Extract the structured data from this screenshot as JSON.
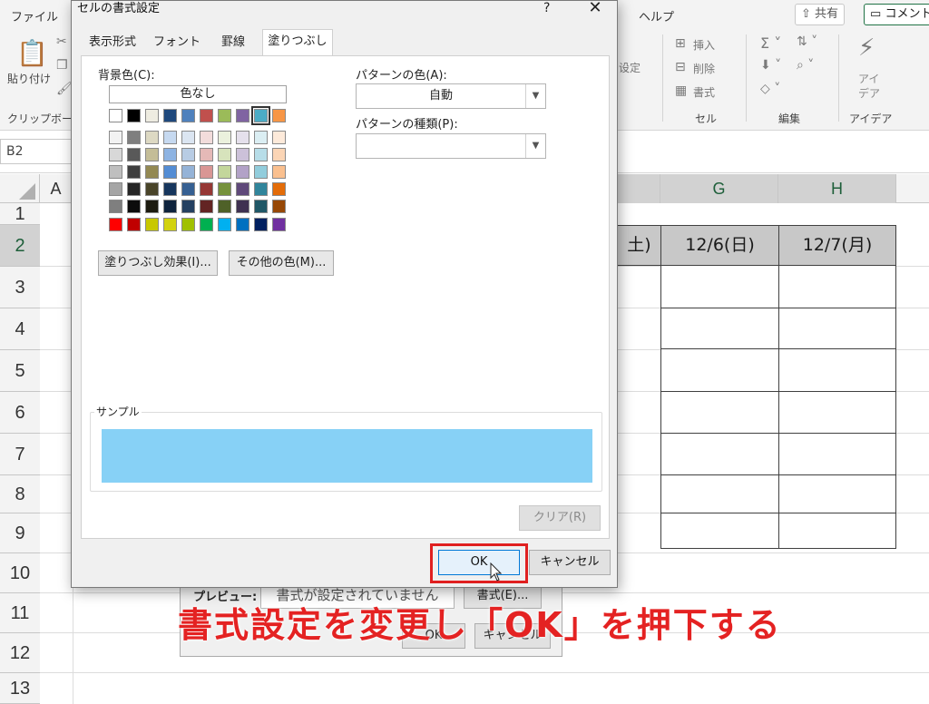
{
  "ribbon": {
    "tabs": [
      "ファイル",
      "ヘルプ"
    ],
    "share_label": "共有",
    "comment_label": "コメント",
    "clipboard": {
      "paste_label": "貼り付け",
      "group_label": "クリップボード"
    },
    "style_fragment": "设定",
    "cells": {
      "insert_label": "挿入",
      "delete_label": "削除",
      "format_label": "書式",
      "group_label": "セル"
    },
    "editing": {
      "group_label": "編集"
    },
    "ideas": {
      "label_line1": "アイ",
      "label_line2": "デア",
      "group_label": "アイデア"
    }
  },
  "name_box": "B2",
  "sheet": {
    "columns": [
      "A",
      "G",
      "H"
    ],
    "rows": [
      "1",
      "2",
      "3",
      "4",
      "5",
      "6",
      "7",
      "8",
      "9",
      "10",
      "11",
      "12",
      "13"
    ],
    "header_cells": [
      "土)",
      "12/6(日)",
      "12/7(月)"
    ]
  },
  "back_dialog": {
    "preview_label": "プレビュー:",
    "preview_text": "書式が設定されていません",
    "format_button": "書式(E)...",
    "ok_button": "OK",
    "cancel_button": "キャンセル"
  },
  "dialog": {
    "title": "セルの書式設定",
    "help": "?",
    "close": "✕",
    "tabs": [
      "表示形式",
      "フォント",
      "罫線",
      "塗りつぶし"
    ],
    "active_tab": "塗りつぶし",
    "background_color_label": "背景色(C):",
    "no_color_button": "色なし",
    "fill_effects_button": "塗りつぶし効果(I)...",
    "more_colors_button": "その他の色(M)...",
    "pattern_color_label": "パターンの色(A):",
    "pattern_color_value": "自動",
    "pattern_style_label": "パターンの種類(P):",
    "pattern_style_value": "",
    "sample_label": "サンプル",
    "sample_color": "#87d1f6",
    "clear_button": "クリア(R)",
    "ok_button": "OK",
    "cancel_button": "キャンセル",
    "palette": {
      "row1": [
        "#ffffff",
        "#000000",
        "#eeece1",
        "#1f497d",
        "#4f81bd",
        "#c0504d",
        "#9bbb59",
        "#8064a2",
        "#4bacc6",
        "#f79646"
      ],
      "theme_rows": [
        [
          "#f2f2f2",
          "#7f7f7f",
          "#ddd9c3",
          "#c6d9f0",
          "#dbe5f1",
          "#f2dcdb",
          "#ebf1dd",
          "#e5e0ec",
          "#dbeef3",
          "#fdeada"
        ],
        [
          "#d8d8d8",
          "#595959",
          "#c4bd97",
          "#8db3e2",
          "#b8cce4",
          "#e5b9b7",
          "#d7e3bc",
          "#ccc1d9",
          "#b7dde8",
          "#fbd5b5"
        ],
        [
          "#bfbfbf",
          "#3f3f3f",
          "#938953",
          "#548dd4",
          "#95b3d7",
          "#d99694",
          "#c3d69b",
          "#b2a2c7",
          "#92cddc",
          "#fac08f"
        ],
        [
          "#a5a5a5",
          "#262626",
          "#494429",
          "#17365d",
          "#366092",
          "#953734",
          "#76923c",
          "#5f497a",
          "#31859b",
          "#e36c09"
        ],
        [
          "#7f7f7f",
          "#0c0c0c",
          "#1d1b10",
          "#0f243e",
          "#244061",
          "#632423",
          "#4f6128",
          "#3f3151",
          "#205867",
          "#974806"
        ]
      ],
      "standard": [
        "#ff0000",
        "#c00000",
        "#c8c800",
        "#d2d20f",
        "#a0c000",
        "#00b050",
        "#00b0f0",
        "#0070c0",
        "#002060",
        "#7030a0"
      ],
      "selected_color": "#4bacc6"
    }
  },
  "annotation": "書式設定を変更し「OK」を押下する",
  "colors": {
    "highlight": "#e02020",
    "annotation": "#e42222",
    "excel_green": "#217346"
  }
}
